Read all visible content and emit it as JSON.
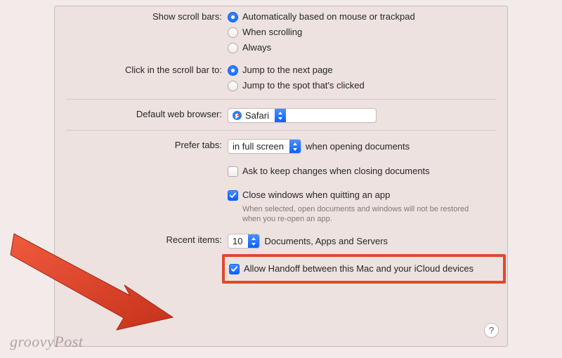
{
  "scrollbars": {
    "label": "Show scroll bars:",
    "opts": {
      "auto": "Automatically based on mouse or trackpad",
      "scrolling": "When scrolling",
      "always": "Always"
    }
  },
  "clickbar": {
    "label": "Click in the scroll bar to:",
    "opts": {
      "nextpage": "Jump to the next page",
      "spot": "Jump to the spot that's clicked"
    }
  },
  "browser": {
    "label": "Default web browser:",
    "value": "Safari"
  },
  "tabs": {
    "label": "Prefer tabs:",
    "select_value": "in full screen",
    "suffix": "when opening documents"
  },
  "ask_changes": {
    "label": "Ask to keep changes when closing documents"
  },
  "close_windows": {
    "label": "Close windows when quitting an app",
    "desc": "When selected, open documents and windows will not be restored when you re-open an app."
  },
  "recent": {
    "label": "Recent items:",
    "value": "10",
    "suffix": "Documents, Apps and Servers"
  },
  "handoff": {
    "label": "Allow Handoff between this Mac and your iCloud devices"
  },
  "help": "?",
  "watermark": "groovyPost"
}
